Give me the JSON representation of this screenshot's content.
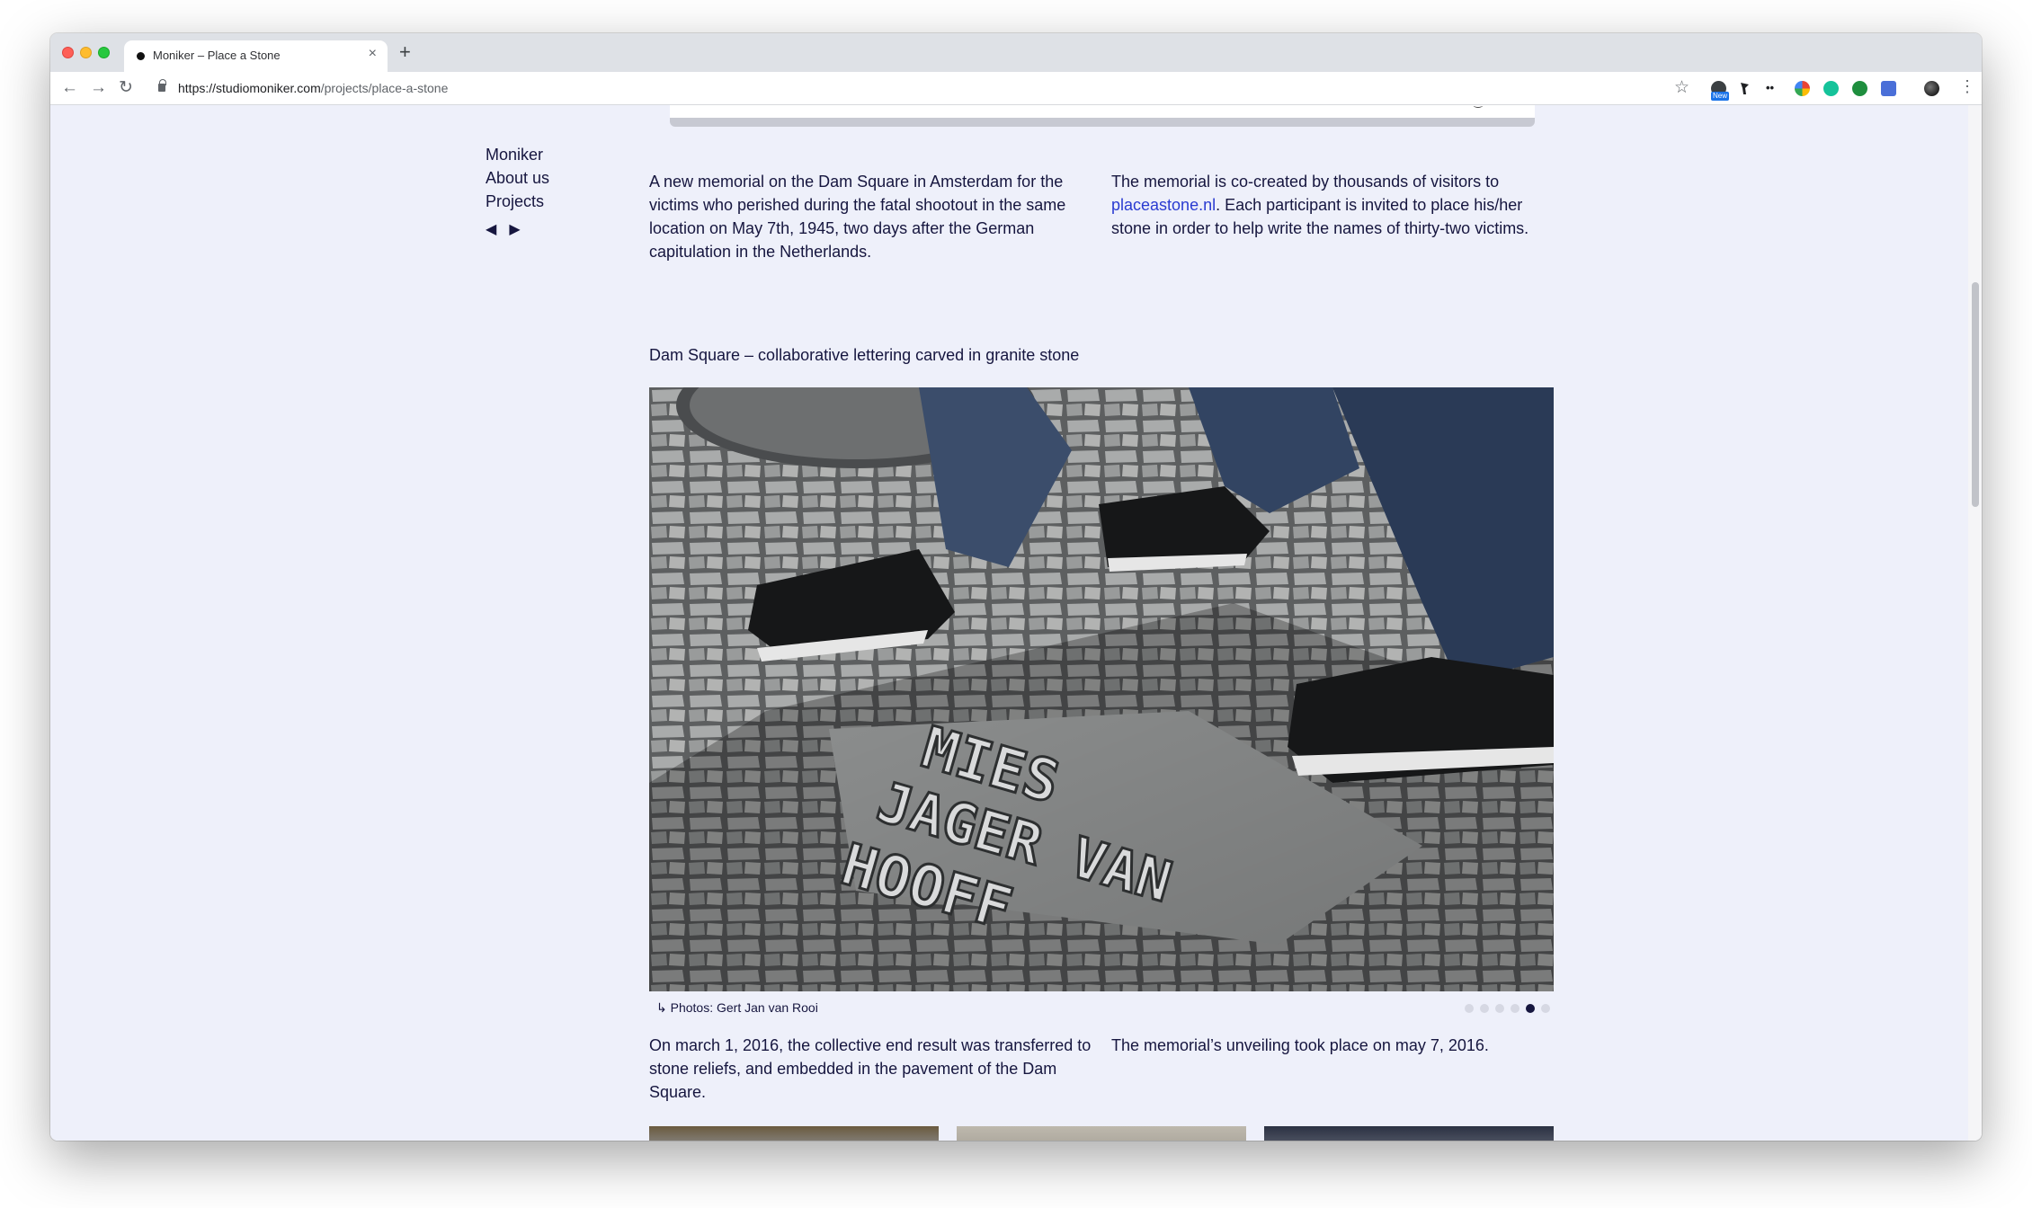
{
  "browser": {
    "tab_title": "Moniker – Place a Stone",
    "tab_close": "×",
    "new_tab": "+",
    "url_host": "https://studiomoniker.com",
    "url_path": "/projects/place-a-stone",
    "nav_back": "←",
    "nav_forward": "→",
    "nav_reload": "↻",
    "bookmark_star": "☆",
    "menu": "⋮",
    "extension_badge": "New",
    "icons": [
      "back-arrow-icon",
      "forward-arrow-icon",
      "reload-icon",
      "lock-icon",
      "star-icon",
      "extension-icons",
      "profile-avatar",
      "kebab-menu-icon"
    ]
  },
  "sidebar": {
    "links": [
      "Moniker",
      "About us",
      "Projects"
    ],
    "prev_arrow": "◀",
    "next_arrow": "▶"
  },
  "content": {
    "intro_left": "A new memorial on the Dam Square in Amsterdam for the victims who perished during the fatal shootout in the same location on May 7th, 1945, two days after the German capitulation in the Netherlands.",
    "intro_right_before_link": "The memorial is co-created by thousands of visitors to ",
    "intro_right_link": "placeastone.nl",
    "intro_right_after_link": ". Each participant is invited to place his/her stone in order to help write the names of thirty-two victims.",
    "gallery_title": "Dam Square – collaborative lettering carved in granite stone",
    "photo_lettering": [
      "MIES",
      "JAGER VAN",
      "HOOFF"
    ],
    "photo_credit": "↳ Photos: Gert Jan van Rooi",
    "gallery_dots_total": 6,
    "gallery_dots_active": 5,
    "outro_left": "On march 1, 2016, the collective end result was transferred to stone reliefs, and embedded in the pavement of the Dam Square.",
    "outro_right": "The memorial’s unveiling took place on may 7, 2016."
  },
  "colors": {
    "page_background": "#eef0fa",
    "text": "#16163f",
    "link": "#2a3bd1"
  }
}
